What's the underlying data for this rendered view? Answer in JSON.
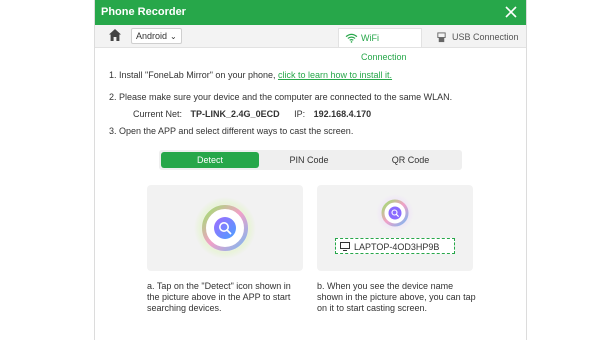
{
  "window": {
    "title": "Phone Recorder"
  },
  "toolbar": {
    "os_selected": "Android",
    "tabs": [
      {
        "label": "WiFi Connection",
        "active": true
      },
      {
        "label": "USB Connection",
        "active": false
      }
    ]
  },
  "steps": {
    "step1_text": "1. Install \"FoneLab Mirror\" on your phone,",
    "step1_link": "click to learn how to install it.",
    "step2_text": "2. Please make sure your device and the computer are connected to the same WLAN.",
    "current_net_label": "Current Net:",
    "current_net_value": "TP-LINK_2.4G_0ECD",
    "ip_label": "IP:",
    "ip_value": "192.168.4.170",
    "step3_text": "3. Open the APP and select different ways to cast the screen."
  },
  "methods": {
    "items": [
      "Detect",
      "PIN Code",
      "QR Code"
    ],
    "selected": "Detect"
  },
  "device": {
    "name": "LAPTOP-4OD3HP9B"
  },
  "captions": {
    "a": "a. Tap on the \"Detect\" icon shown in the picture above in the APP to start searching devices.",
    "b": "b. When you see the device name shown in the picture above, you can tap on it to start casting screen."
  },
  "colors": {
    "accent": "#27a74a",
    "title_bg": "#27a74a"
  }
}
